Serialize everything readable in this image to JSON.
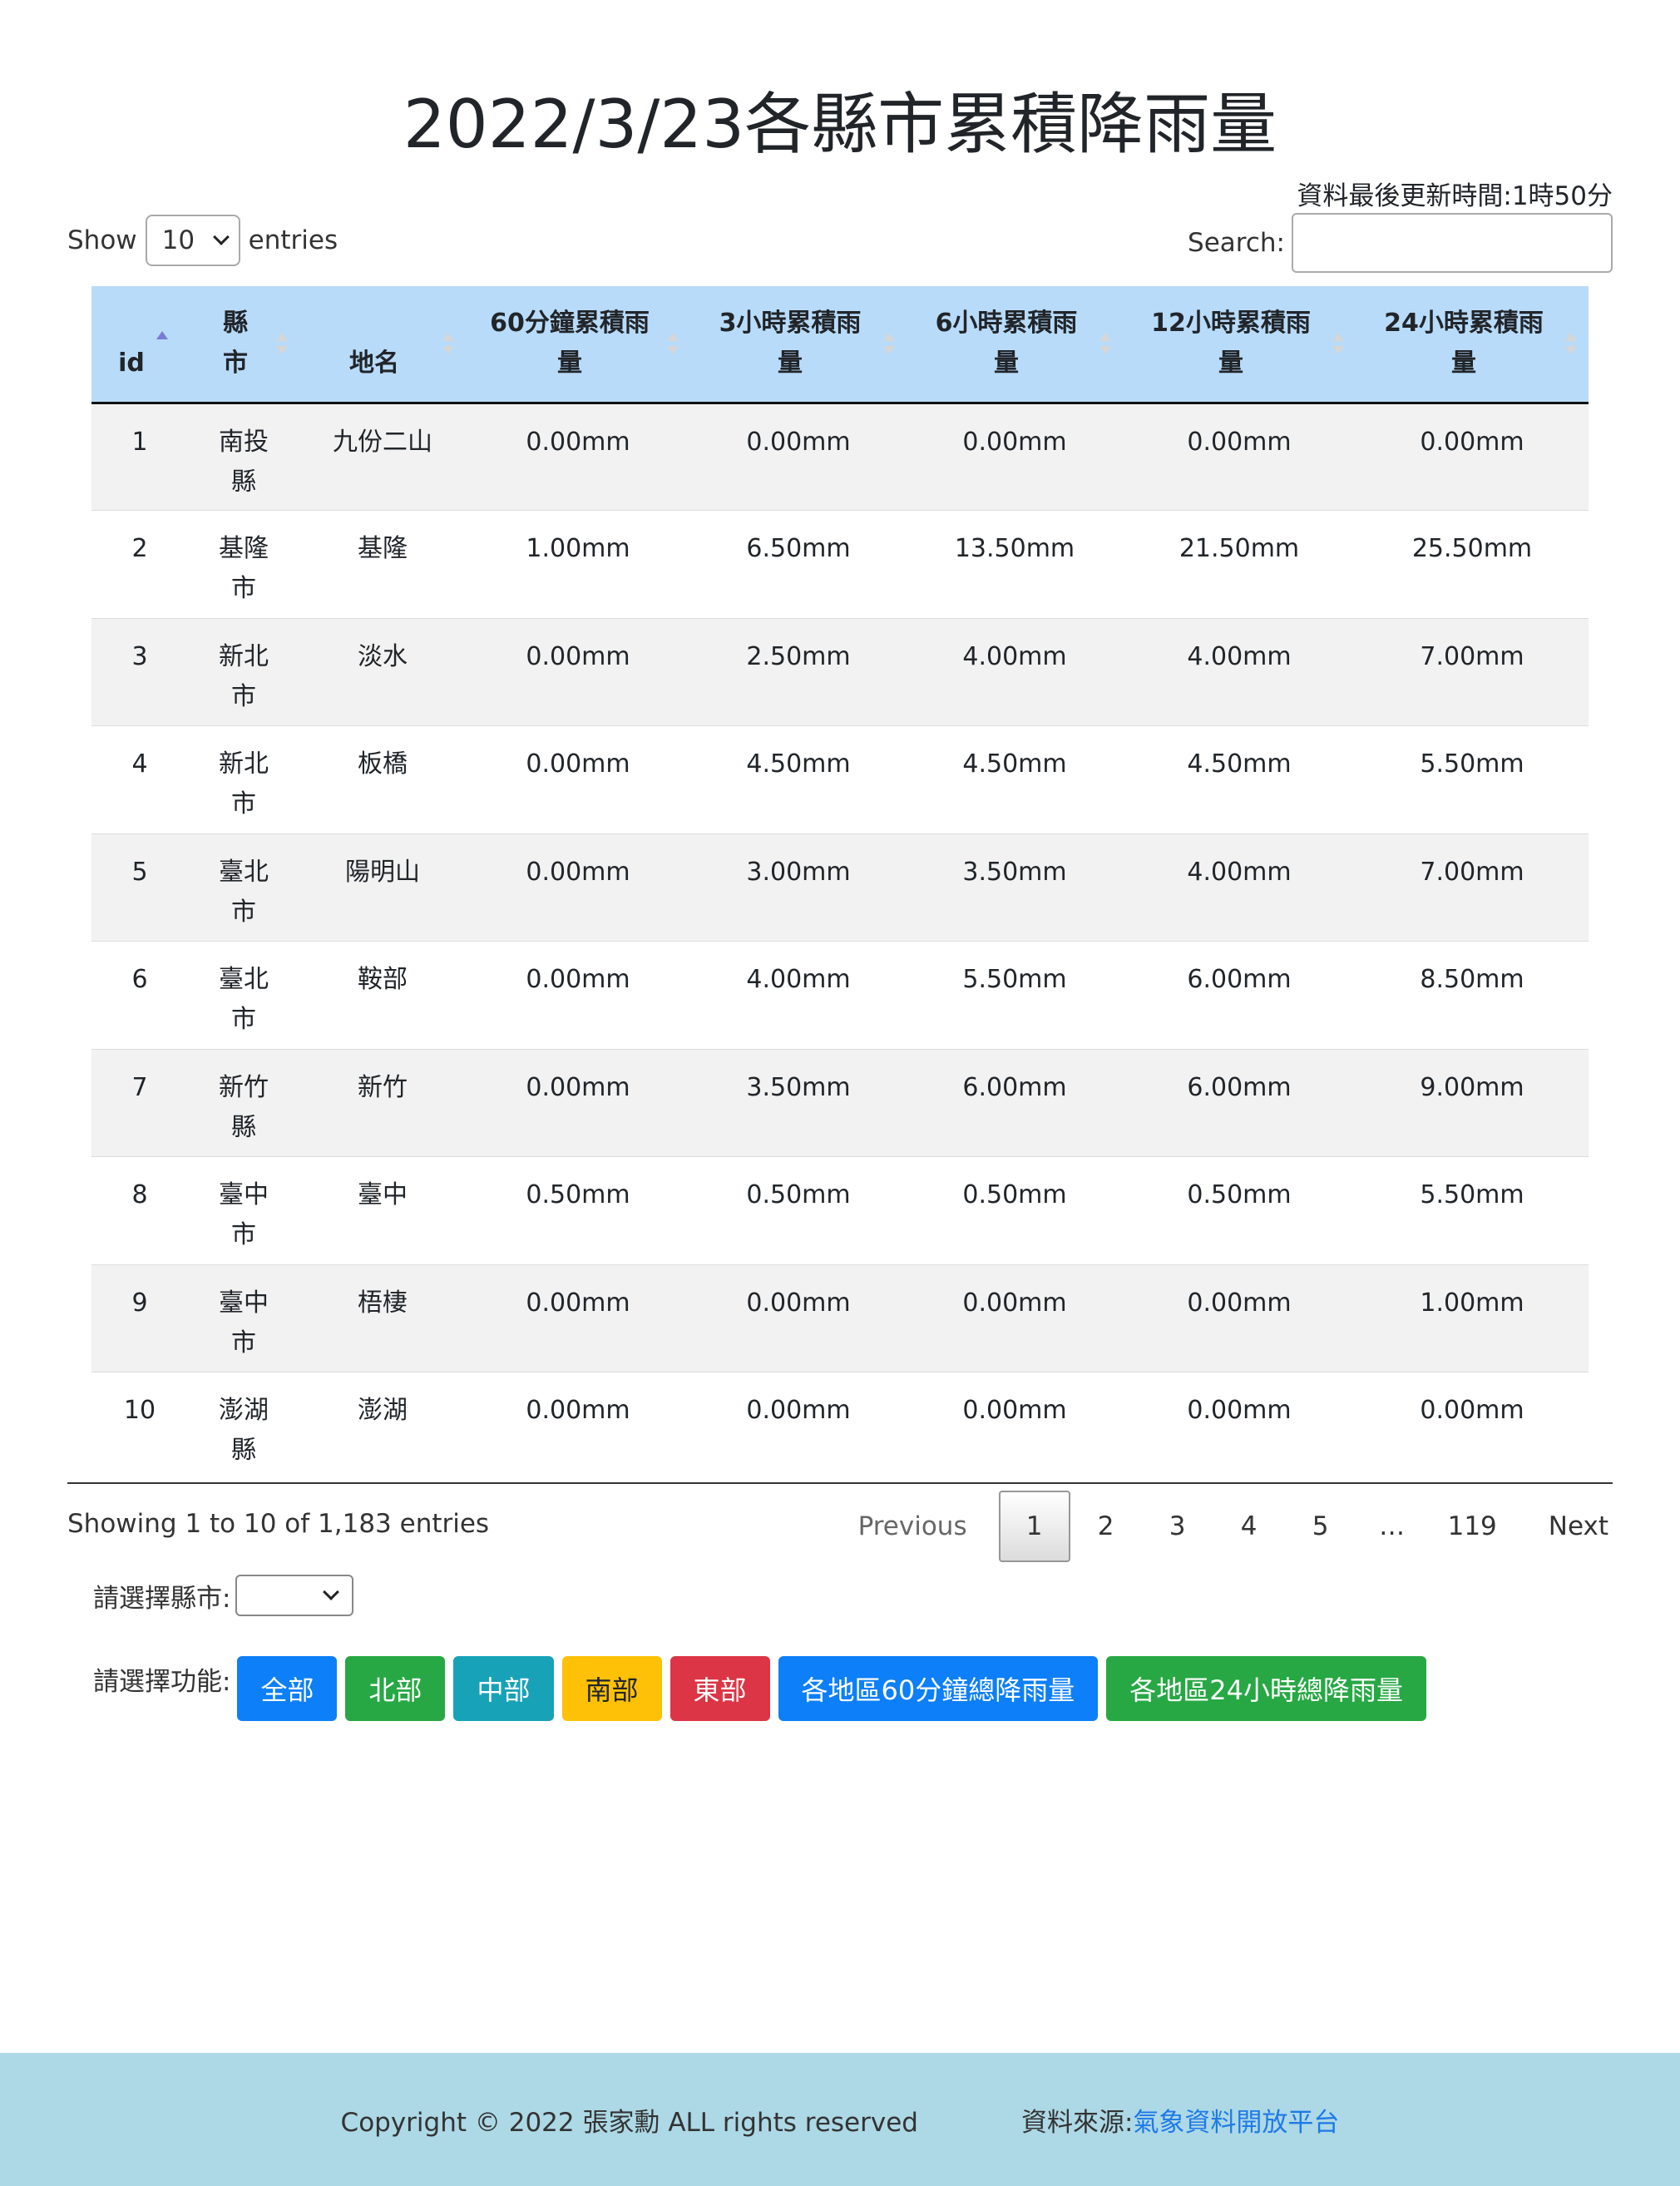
{
  "page": {
    "title": "2022/3/23各縣市累積降雨量",
    "update_time": "資料最後更新時間:1時50分"
  },
  "length_control": {
    "show": "Show",
    "value": "10",
    "entries": "entries"
  },
  "search": {
    "label": "Search:",
    "value": ""
  },
  "table": {
    "headers": [
      {
        "line1": "",
        "line2": "id"
      },
      {
        "line1": "縣",
        "line2": "市"
      },
      {
        "line1": "",
        "line2": "地名"
      },
      {
        "line1": "60分鐘累積雨",
        "line2": "量"
      },
      {
        "line1": "3小時累積雨",
        "line2": "量"
      },
      {
        "line1": "6小時累積雨",
        "line2": "量"
      },
      {
        "line1": "12小時累積雨",
        "line2": "量"
      },
      {
        "line1": "24小時累積雨",
        "line2": "量"
      }
    ],
    "rows": [
      {
        "id": "1",
        "c1": "南投",
        "c2": "縣",
        "place": "九份二山",
        "m60": "0.00mm",
        "h3": "0.00mm",
        "h6": "0.00mm",
        "h12": "0.00mm",
        "h24": "0.00mm"
      },
      {
        "id": "2",
        "c1": "基隆",
        "c2": "市",
        "place": "基隆",
        "m60": "1.00mm",
        "h3": "6.50mm",
        "h6": "13.50mm",
        "h12": "21.50mm",
        "h24": "25.50mm"
      },
      {
        "id": "3",
        "c1": "新北",
        "c2": "市",
        "place": "淡水",
        "m60": "0.00mm",
        "h3": "2.50mm",
        "h6": "4.00mm",
        "h12": "4.00mm",
        "h24": "7.00mm"
      },
      {
        "id": "4",
        "c1": "新北",
        "c2": "市",
        "place": "板橋",
        "m60": "0.00mm",
        "h3": "4.50mm",
        "h6": "4.50mm",
        "h12": "4.50mm",
        "h24": "5.50mm"
      },
      {
        "id": "5",
        "c1": "臺北",
        "c2": "市",
        "place": "陽明山",
        "m60": "0.00mm",
        "h3": "3.00mm",
        "h6": "3.50mm",
        "h12": "4.00mm",
        "h24": "7.00mm"
      },
      {
        "id": "6",
        "c1": "臺北",
        "c2": "市",
        "place": "鞍部",
        "m60": "0.00mm",
        "h3": "4.00mm",
        "h6": "5.50mm",
        "h12": "6.00mm",
        "h24": "8.50mm"
      },
      {
        "id": "7",
        "c1": "新竹",
        "c2": "縣",
        "place": "新竹",
        "m60": "0.00mm",
        "h3": "3.50mm",
        "h6": "6.00mm",
        "h12": "6.00mm",
        "h24": "9.00mm"
      },
      {
        "id": "8",
        "c1": "臺中",
        "c2": "市",
        "place": "臺中",
        "m60": "0.50mm",
        "h3": "0.50mm",
        "h6": "0.50mm",
        "h12": "0.50mm",
        "h24": "5.50mm"
      },
      {
        "id": "9",
        "c1": "臺中",
        "c2": "市",
        "place": "梧棲",
        "m60": "0.00mm",
        "h3": "0.00mm",
        "h6": "0.00mm",
        "h12": "0.00mm",
        "h24": "1.00mm"
      },
      {
        "id": "10",
        "c1": "澎湖",
        "c2": "縣",
        "place": "澎湖",
        "m60": "0.00mm",
        "h3": "0.00mm",
        "h6": "0.00mm",
        "h12": "0.00mm",
        "h24": "0.00mm"
      }
    ]
  },
  "info": "Showing 1 to 10 of 1,183 entries",
  "pagination": {
    "previous": "Previous",
    "pages": [
      "1",
      "2",
      "3",
      "4",
      "5",
      "…",
      "119"
    ],
    "current": "1",
    "next": "Next"
  },
  "city_select": {
    "label": "請選擇縣市:",
    "value": ""
  },
  "functions": {
    "label": "請選擇功能:",
    "buttons": [
      {
        "label": "全部",
        "color": "#0d7ff8",
        "text_color": "#ffffff"
      },
      {
        "label": "北部",
        "color": "#27a844",
        "text_color": "#ffffff"
      },
      {
        "label": "中部",
        "color": "#17a2b8",
        "text_color": "#ffffff"
      },
      {
        "label": "南部",
        "color": "#ffc107",
        "text_color": "#212529"
      },
      {
        "label": "東部",
        "color": "#dc3545",
        "text_color": "#ffffff"
      },
      {
        "label": "各地區60分鐘總降雨量",
        "color": "#0d7ff8",
        "text_color": "#ffffff"
      },
      {
        "label": "各地區24小時總降雨量",
        "color": "#27a844",
        "text_color": "#ffffff"
      }
    ]
  },
  "footer": {
    "copyright": "Copyright © 2022 張家勳 ALL rights reserved",
    "source_label": "資料來源:",
    "source_link": "氣象資料開放平台",
    "background": "#add8e6",
    "link_color": "#1e7ae6"
  }
}
